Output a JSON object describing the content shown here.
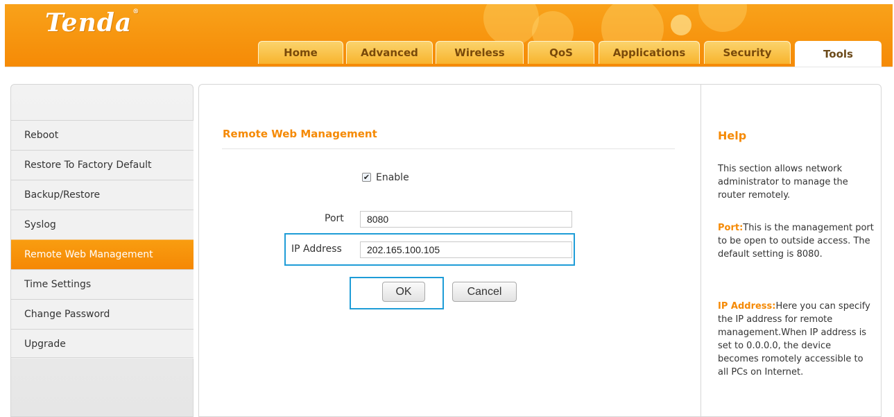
{
  "brand": {
    "logo_text": "Tenda",
    "registered_mark": "®"
  },
  "nav": {
    "tabs": [
      {
        "label": "Home",
        "active": false
      },
      {
        "label": "Advanced",
        "active": false
      },
      {
        "label": "Wireless",
        "active": false
      },
      {
        "label": "QoS",
        "active": false
      },
      {
        "label": "Applications",
        "active": false
      },
      {
        "label": "Security",
        "active": false
      },
      {
        "label": "Tools",
        "active": true
      }
    ]
  },
  "sidebar": {
    "items": [
      {
        "label": "Reboot",
        "active": false
      },
      {
        "label": "Restore To Factory Default",
        "active": false
      },
      {
        "label": "Backup/Restore",
        "active": false
      },
      {
        "label": "Syslog",
        "active": false
      },
      {
        "label": "Remote Web Management",
        "active": true
      },
      {
        "label": "Time Settings",
        "active": false
      },
      {
        "label": "Change Password",
        "active": false
      },
      {
        "label": "Upgrade",
        "active": false
      }
    ]
  },
  "form": {
    "title": "Remote Web Management",
    "enable_label": "Enable",
    "enable_checked": true,
    "port_label": "Port",
    "port_value": "8080",
    "ip_label": "IP Address",
    "ip_value": "202.165.100.105",
    "ok_label": "OK",
    "cancel_label": "Cancel"
  },
  "help": {
    "title": "Help",
    "intro": "This section allows network administrator to manage the router remotely.",
    "port_key": "Port:",
    "port_text": "This is the management port to be open to outside access. The default setting is 8080.",
    "ip_key": "IP Address:",
    "ip_text": "Here you can specify the IP address for remote management.When IP address is set to 0.0.0.0, the device becomes romotely accessible to all PCs on Internet."
  },
  "colors": {
    "brand_orange": "#f58a06",
    "highlight_blue": "#1e9cd7"
  }
}
